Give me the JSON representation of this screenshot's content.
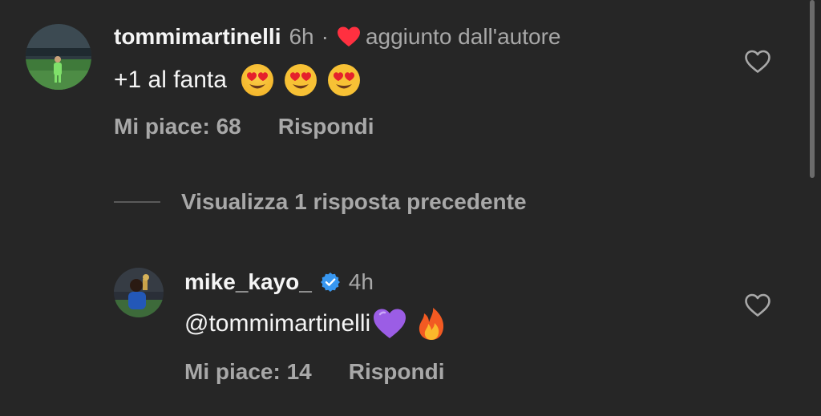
{
  "comment": {
    "username": "tommimartinelli",
    "time": "6h",
    "separator": "·",
    "author_liked_label": "aggiunto dall'autore",
    "text": "+1 al fanta",
    "emojis": [
      "heart-eyes-emoji",
      "heart-eyes-emoji",
      "heart-eyes-emoji"
    ],
    "likes_label": "Mi piace: 68",
    "reply_label": "Rispondi"
  },
  "view_replies_label": "Visualizza 1 risposta precedente",
  "reply": {
    "username": "mike_kayo_",
    "verified": true,
    "time": "4h",
    "text": "@tommimartinelli",
    "emojis": [
      "purple-heart-emoji",
      "fire-emoji"
    ],
    "likes_label": "Mi piace: 14",
    "reply_label": "Rispondi"
  },
  "colors": {
    "background": "#262626",
    "primary_text": "#f5f5f5",
    "secondary_text": "#a8a8a8",
    "author_heart": "#ff3040",
    "verified_badge": "#3897f0"
  }
}
